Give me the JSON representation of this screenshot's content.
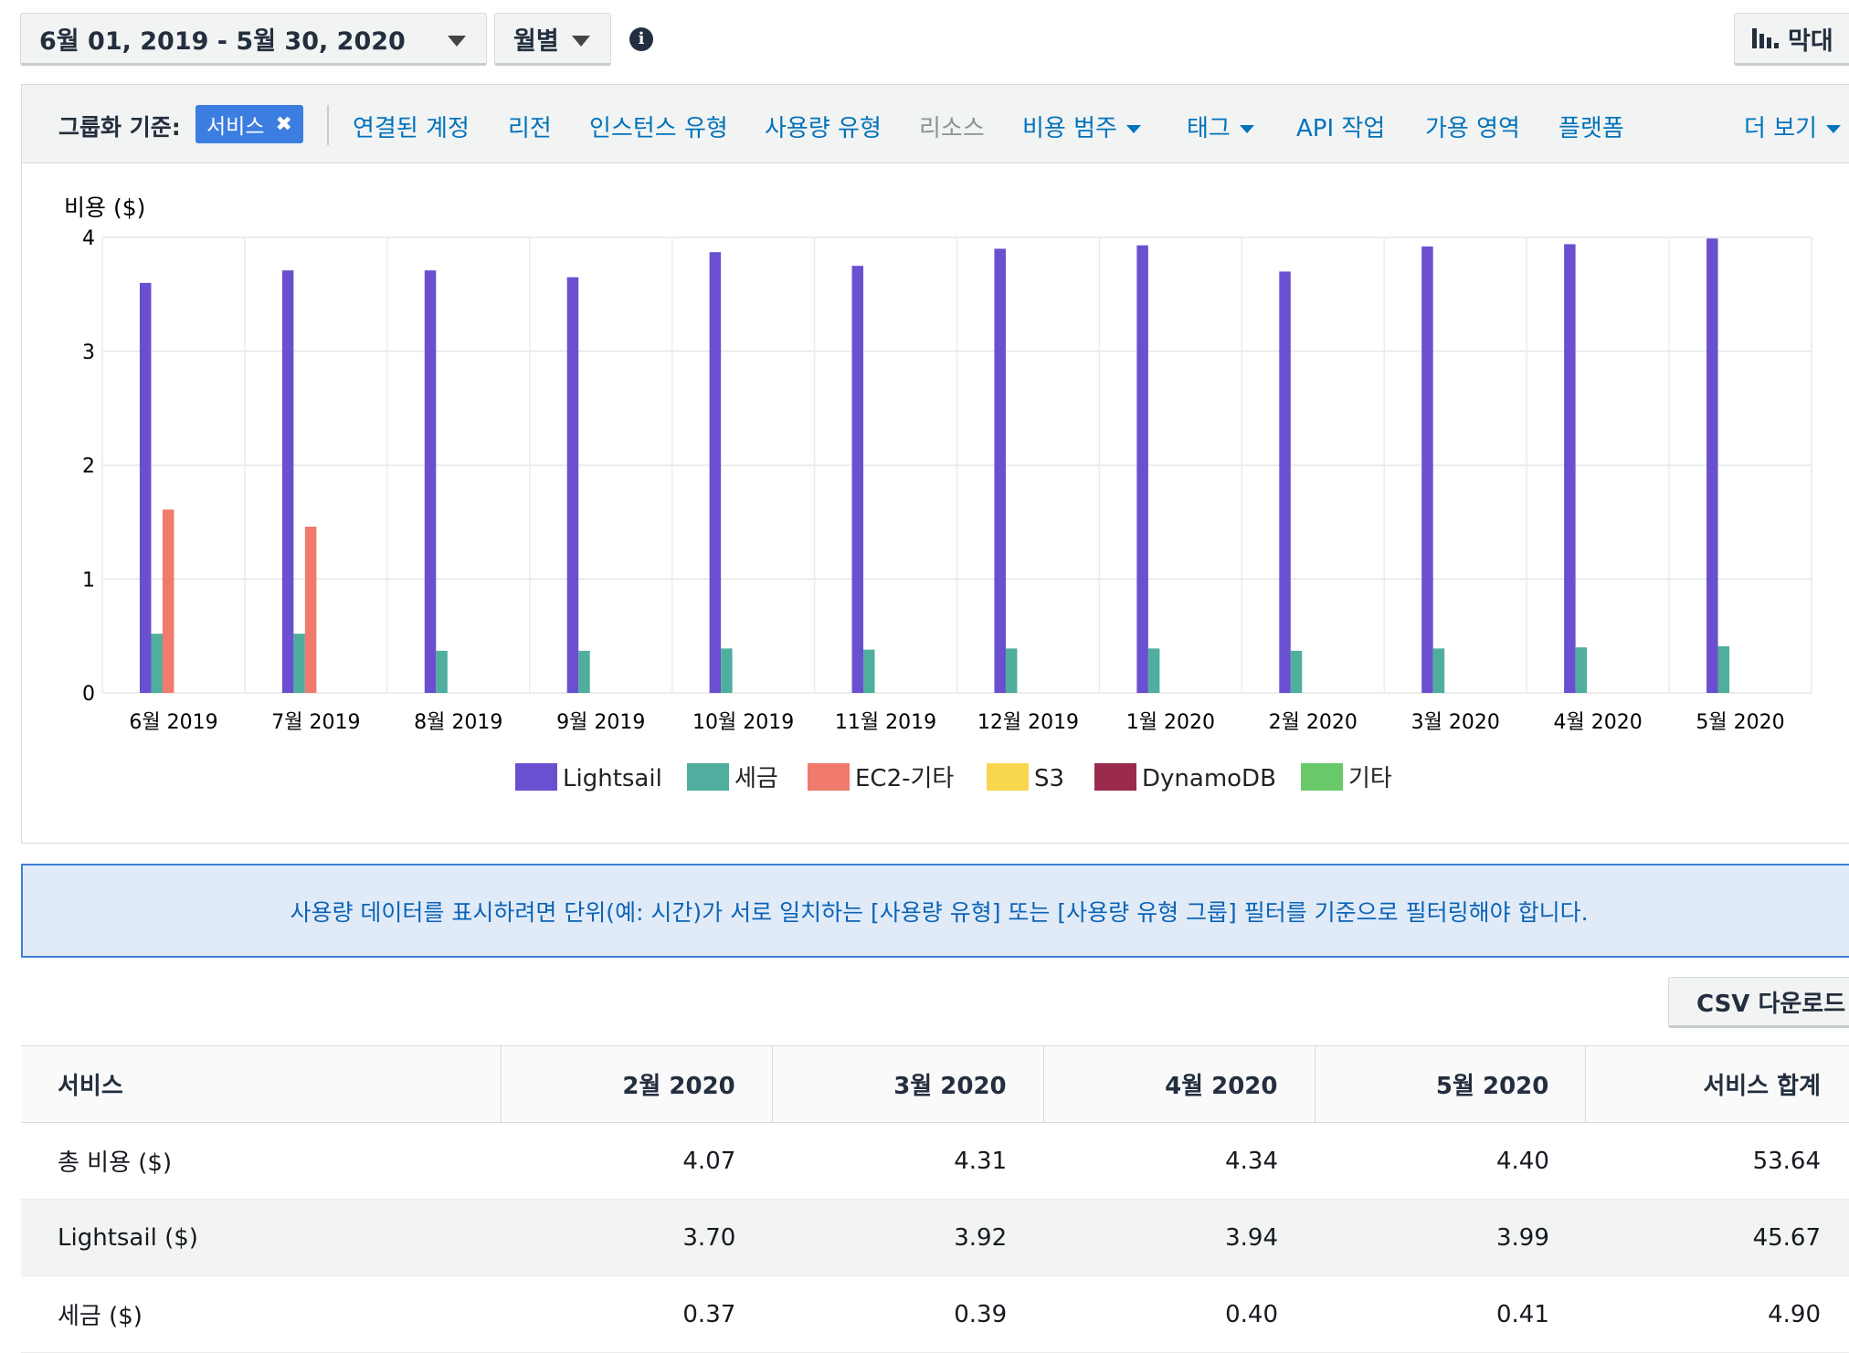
{
  "toolbar": {
    "date_range": "6월 01, 2019 - 5월 30, 2020",
    "granularity": "월별",
    "chart_type": "막대"
  },
  "group_by": {
    "label": "그룹화 기준:",
    "selected_chip": "서비스",
    "options": [
      {
        "label": "연결된 계정",
        "enabled": true,
        "dropdown": false
      },
      {
        "label": "리전",
        "enabled": true,
        "dropdown": false
      },
      {
        "label": "인스턴스 유형",
        "enabled": true,
        "dropdown": false
      },
      {
        "label": "사용량 유형",
        "enabled": true,
        "dropdown": false
      },
      {
        "label": "리소스",
        "enabled": false,
        "dropdown": false
      },
      {
        "label": "비용 범주",
        "enabled": true,
        "dropdown": true
      },
      {
        "label": "태그",
        "enabled": true,
        "dropdown": true
      },
      {
        "label": "API 작업",
        "enabled": true,
        "dropdown": false
      },
      {
        "label": "가용 영역",
        "enabled": true,
        "dropdown": false
      },
      {
        "label": "플랫폼",
        "enabled": true,
        "dropdown": false
      }
    ],
    "more": "더 보기"
  },
  "chart_data": {
    "type": "bar",
    "ylabel": "비용 ($)",
    "xlabel": "",
    "ylim": [
      0,
      4
    ],
    "yticks": [
      "0",
      "1",
      "2",
      "3",
      "4"
    ],
    "grid": true,
    "legend_position": "bottom",
    "categories": [
      "6월 2019",
      "7월 2019",
      "8월 2019",
      "9월 2019",
      "10월 2019",
      "11월 2019",
      "12월 2019",
      "1월 2020",
      "2월 2020",
      "3월 2020",
      "4월 2020",
      "5월 2020"
    ],
    "series": [
      {
        "name": "Lightsail",
        "color": "#6a4fd0",
        "values": [
          3.6,
          3.71,
          3.71,
          3.65,
          3.87,
          3.75,
          3.9,
          3.93,
          3.7,
          3.92,
          3.94,
          3.99
        ]
      },
      {
        "name": "세금",
        "color": "#4fae9d",
        "values": [
          0.52,
          0.52,
          0.37,
          0.37,
          0.39,
          0.38,
          0.39,
          0.39,
          0.37,
          0.39,
          0.4,
          0.41
        ]
      },
      {
        "name": "EC2-기타",
        "color": "#f07a6c",
        "values": [
          1.61,
          1.46,
          0,
          0,
          0,
          0,
          0,
          0,
          0,
          0,
          0,
          0
        ]
      },
      {
        "name": "S3",
        "color": "#f8d64e",
        "values": [
          0,
          0,
          0,
          0,
          0,
          0,
          0,
          0,
          0,
          0,
          0,
          0
        ]
      },
      {
        "name": "DynamoDB",
        "color": "#9a2b4c",
        "values": [
          0,
          0,
          0,
          0,
          0,
          0,
          0,
          0,
          0,
          0,
          0,
          0
        ]
      },
      {
        "name": "기타",
        "color": "#69c96a",
        "values": [
          0,
          0,
          0,
          0,
          0,
          0,
          0,
          0,
          0,
          0,
          0,
          0
        ]
      }
    ]
  },
  "banner": {
    "text": "사용량 데이터를 표시하려면 단위(예: 시간)가 서로 일치하는 [사용량 유형] 또는 [사용량 유형 그룹] 필터를 기준으로 필터링해야 합니다."
  },
  "csv_button": "CSV 다운로드",
  "table": {
    "headers": [
      "서비스",
      "2월 2020",
      "3월 2020",
      "4월 2020",
      "5월 2020",
      "서비스 합계"
    ],
    "rows": [
      [
        "총 비용 ($)",
        "4.07",
        "4.31",
        "4.34",
        "4.40",
        "53.64"
      ],
      [
        "Lightsail ($)",
        "3.70",
        "3.92",
        "3.94",
        "3.99",
        "45.67"
      ],
      [
        "세금 ($)",
        "0.37",
        "0.39",
        "0.40",
        "0.41",
        "4.90"
      ]
    ]
  }
}
